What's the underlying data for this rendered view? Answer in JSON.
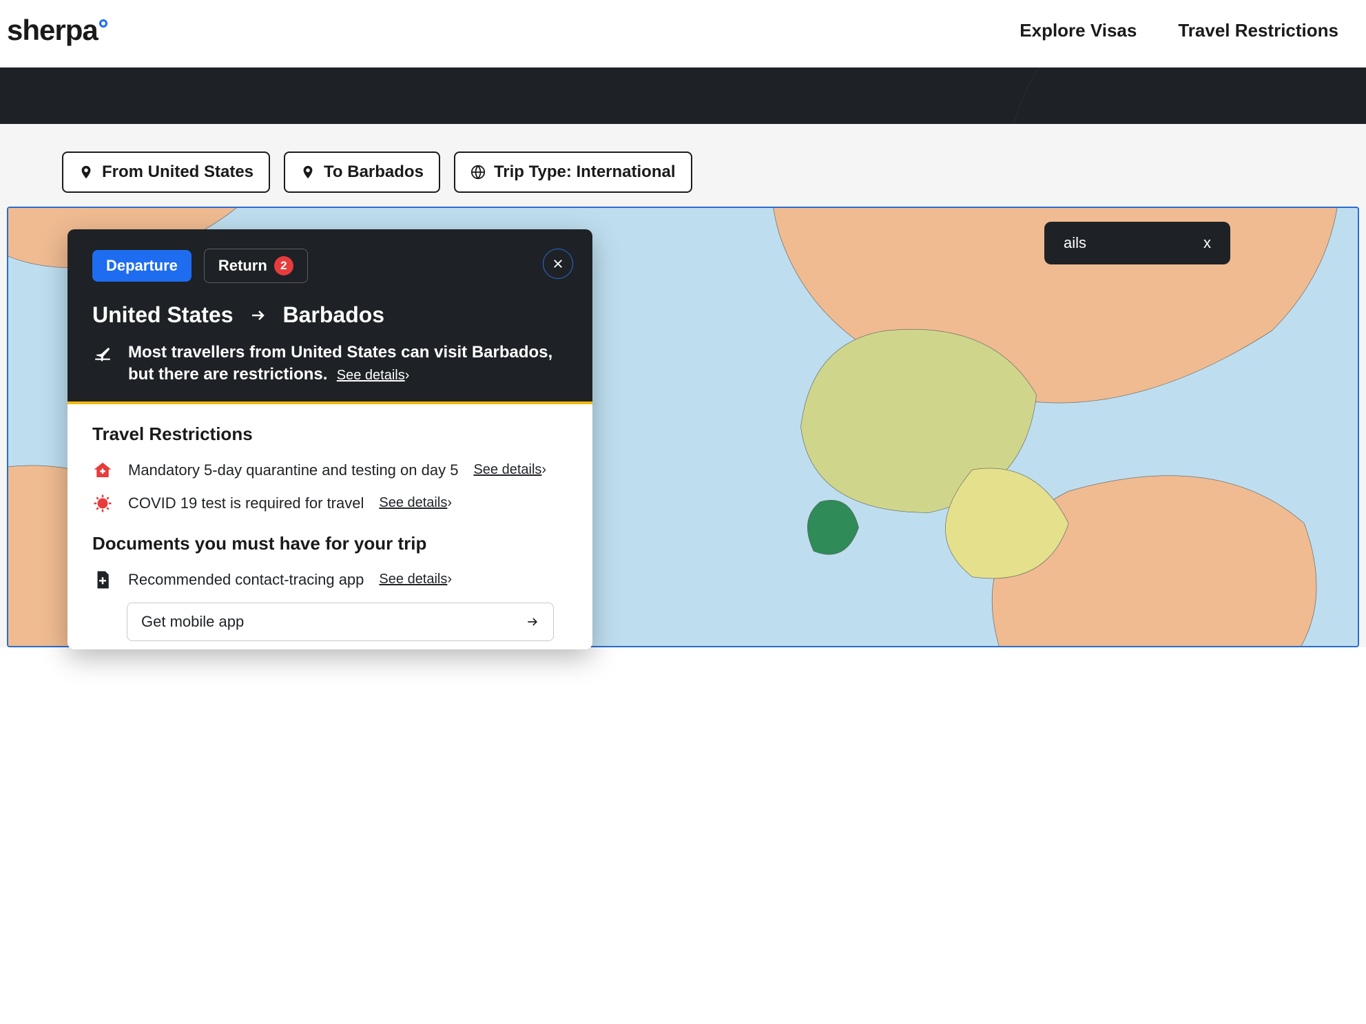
{
  "header": {
    "logo": "sherpa",
    "nav": {
      "visas": "Explore Visas",
      "restrictions": "Travel Restrictions"
    }
  },
  "pills": {
    "from": "From United States",
    "to": "To Barbados",
    "trip": "Trip Type: International"
  },
  "bgCard": {
    "text": "ails",
    "close": "x"
  },
  "modal": {
    "tabs": {
      "departure": "Departure",
      "return": "Return",
      "returnBadge": "2"
    },
    "route": {
      "from": "United States",
      "to": "Barbados"
    },
    "summary": "Most travellers from United States can visit Barbados, but there are restrictions.",
    "seeDetails": "See details",
    "sections": {
      "restrictions": {
        "title": "Travel Restrictions",
        "items": [
          "Mandatory 5-day quarantine and testing on day 5",
          "COVID 19 test is required for travel"
        ]
      },
      "documents": {
        "title": "Documents you must have for your trip",
        "items": [
          "Recommended contact-tracing app"
        ],
        "action": "Get mobile app"
      }
    }
  }
}
